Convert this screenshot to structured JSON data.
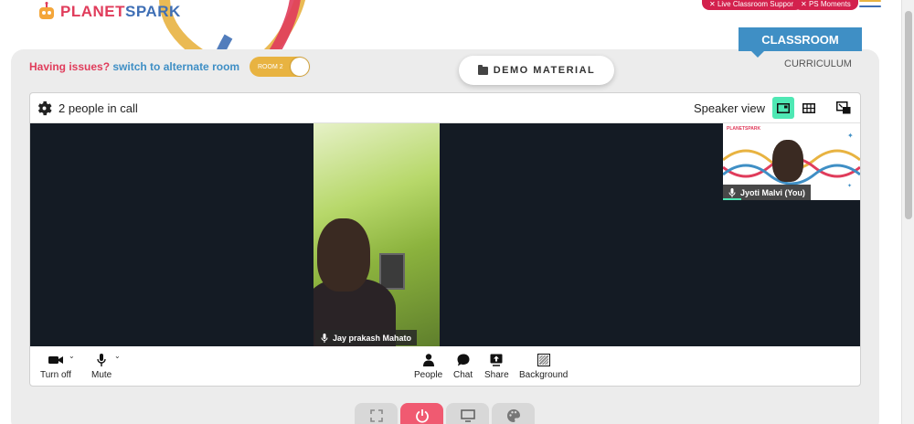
{
  "header": {
    "logo_planet": "PLANET",
    "logo_spark": "SPARK",
    "live_support_label": "Live Classroom Support",
    "ps_moments_label": "PS Moments"
  },
  "tabs": {
    "classroom": "CLASSROOM",
    "curriculum": "CURRICULUM"
  },
  "issue": {
    "question": "Having issues?",
    "link": "switch to alternate room",
    "toggle_label": "ROOM 2"
  },
  "demo_material_label": "DEMO MATERIAL",
  "call": {
    "people_count": "2 people in call",
    "speaker_view_label": "Speaker view",
    "main_participant": "Jay prakash Mahato",
    "self_participant": "Jyoti Malvi (You)",
    "self_logo": "PLANETSPARK",
    "controls": {
      "turn_off": "Turn off",
      "mute": "Mute",
      "people": "People",
      "chat": "Chat",
      "share": "Share",
      "background": "Background"
    }
  },
  "colors": {
    "brand_red": "#d3214d",
    "brand_blue": "#3f8fc5",
    "accent_yellow": "#e8b341",
    "active_view": "#4fe8b4",
    "power_button": "#f05a71"
  }
}
